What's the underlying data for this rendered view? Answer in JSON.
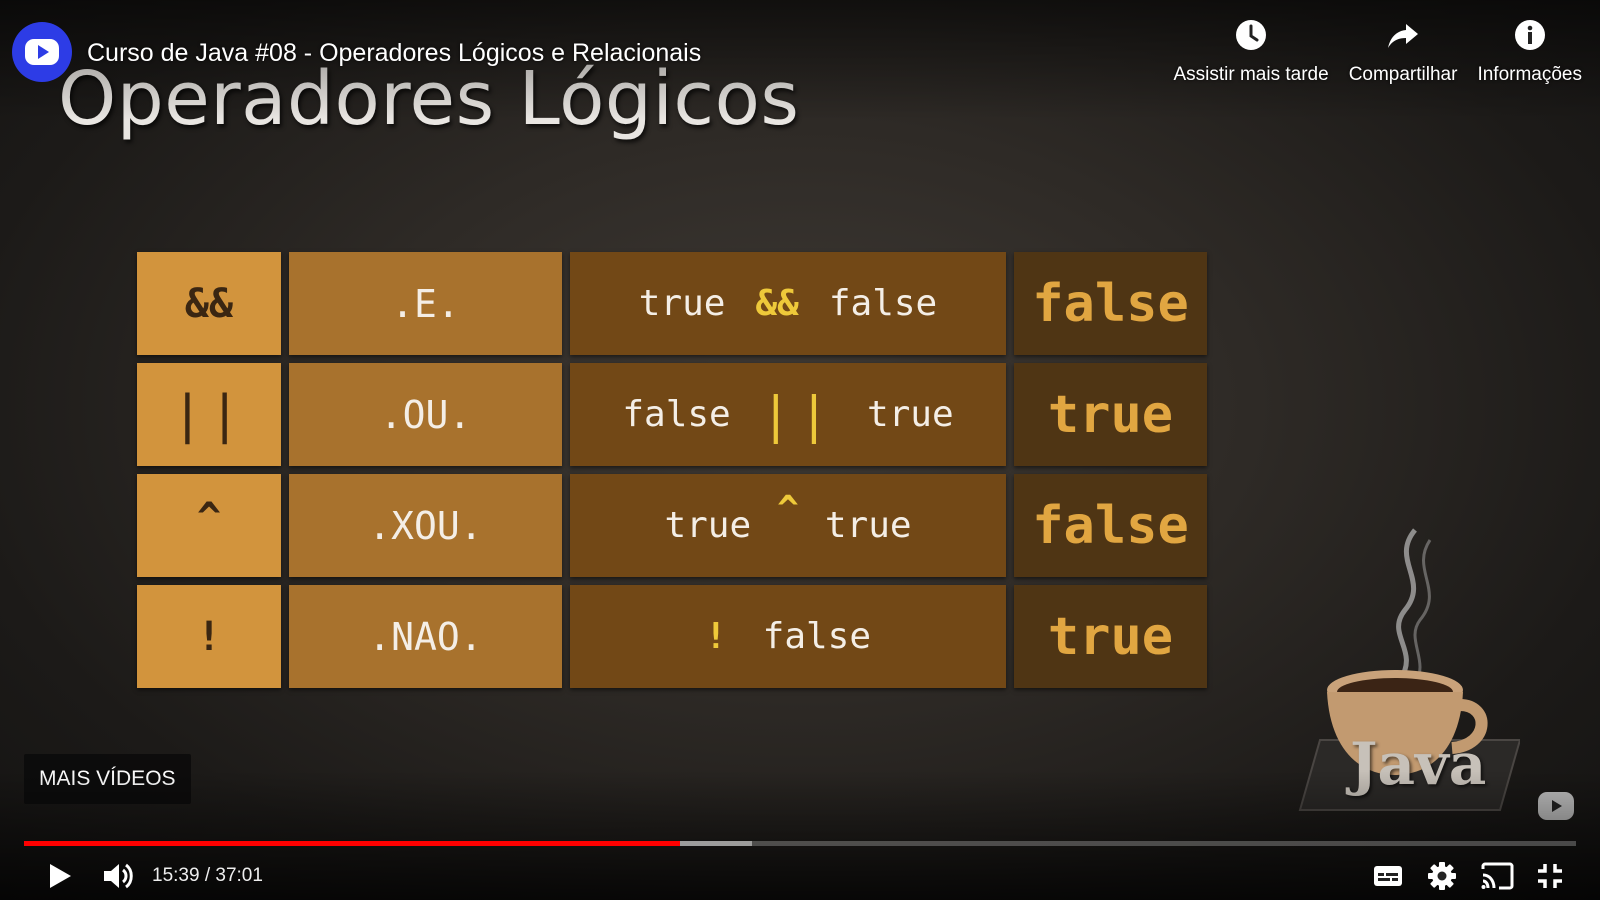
{
  "video": {
    "title": "Curso de Java #08 - Operadores Lógicos e Relacionais"
  },
  "top_actions": {
    "watch_later": "Assistir mais tarde",
    "share": "Compartilhar",
    "info": "Informações"
  },
  "slide": {
    "title": "Operadores Lógicos",
    "rows": [
      {
        "symbol": "&&",
        "name": ".E.",
        "expr_left": "true",
        "expr_op": "&&",
        "expr_right": "false",
        "result": "false"
      },
      {
        "symbol": "||",
        "name": ".OU.",
        "expr_left": "false",
        "expr_op": "||",
        "expr_right": "true",
        "result": "true"
      },
      {
        "symbol": "^",
        "name": ".XOU.",
        "expr_left": "true",
        "expr_op": "^",
        "expr_right": "true",
        "result": "false"
      },
      {
        "symbol": "!",
        "name": ".NAO.",
        "expr_left": "",
        "expr_op": "!",
        "expr_right": "false",
        "result": "true"
      }
    ],
    "art_label": "Java"
  },
  "more_videos_label": "MAIS VÍDEOS",
  "player": {
    "current_time": "15:39",
    "duration": "37:01",
    "time_display": "15:39 / 37:01",
    "played_fraction": 0.423,
    "buffered_fraction": 0.469,
    "accent_color": "#ff0000"
  },
  "icons": {
    "logo": "channel-logo-play-icon",
    "watch_later": "clock-icon",
    "share": "share-arrow-icon",
    "info": "info-icon",
    "play": "play-icon",
    "volume": "volume-icon",
    "subtitles": "subtitles-icon",
    "settings": "gear-icon",
    "cast": "cast-icon",
    "fullscreen_exit": "exit-fullscreen-icon"
  }
}
